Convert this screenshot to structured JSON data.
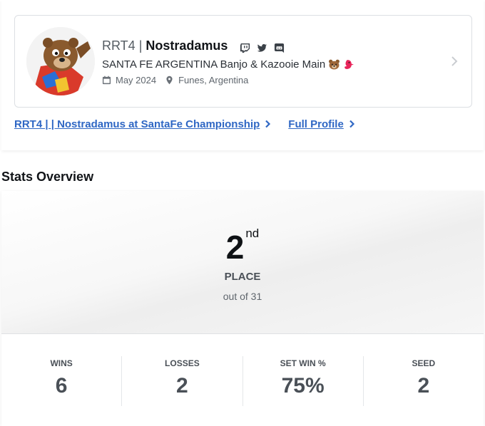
{
  "profile": {
    "prefix": "RRT4",
    "separator": "|",
    "gamertag": "Nostradamus",
    "socials": [
      "twitch-icon",
      "twitter-icon",
      "discord-icon"
    ],
    "bio": "SANTA FE ARGENTINA Banjo & Kazooie Main",
    "bio_emojis": [
      "bear-emoji",
      "bird-emoji"
    ],
    "joined": "May 2024",
    "location": "Funes, Argentina"
  },
  "links": {
    "event_link": "RRT4 | | Nostradamus at SantaFe Championship",
    "profile_link": "Full Profile"
  },
  "stats": {
    "heading": "Stats Overview",
    "place_number": "2",
    "place_suffix": "nd",
    "place_label": "PLACE",
    "place_sub": "out of 31",
    "cells": [
      {
        "label": "WINS",
        "value": "6"
      },
      {
        "label": "LOSSES",
        "value": "2"
      },
      {
        "label": "SET WIN %",
        "value": "75%"
      },
      {
        "label": "SEED",
        "value": "2"
      }
    ]
  },
  "colors": {
    "link": "#2f67c4",
    "text_dark": "#111418",
    "text_muted": "#4a5057",
    "border": "#dcdfe3"
  }
}
